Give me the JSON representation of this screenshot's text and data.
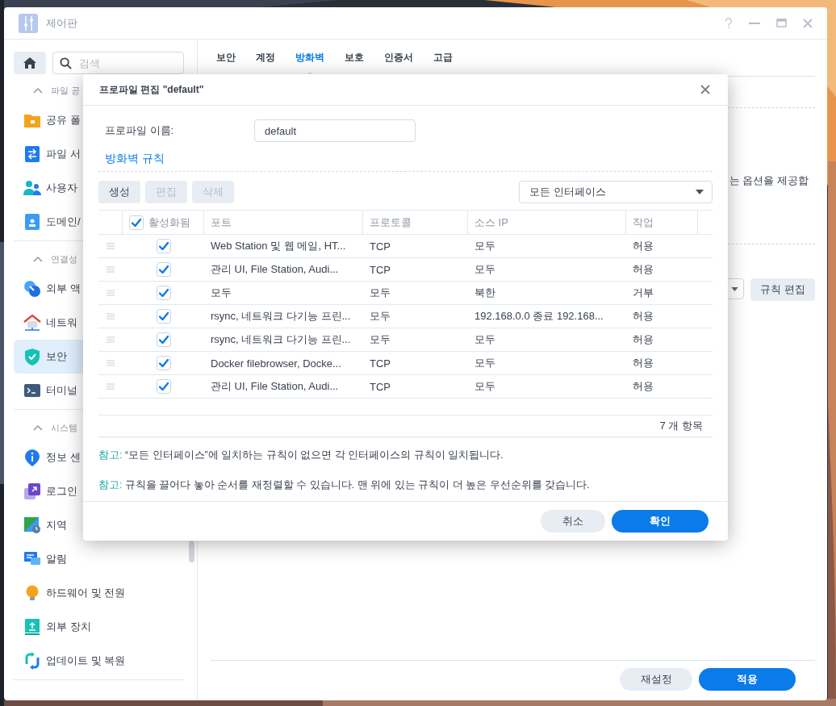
{
  "window": {
    "title": "제어판"
  },
  "sidebar": {
    "search_placeholder": "검색",
    "sections": [
      {
        "title": "파일 공",
        "expanded": true,
        "items": [
          {
            "label": "공유 폴",
            "selected": false
          },
          {
            "label": "파일 서",
            "selected": false
          },
          {
            "label": "사용자",
            "selected": false
          },
          {
            "label": "도메인/",
            "selected": false
          }
        ]
      },
      {
        "title": "연결성",
        "expanded": true,
        "items": [
          {
            "label": "외부 액",
            "selected": false
          },
          {
            "label": "네트워",
            "selected": false
          },
          {
            "label": "보안",
            "selected": true
          },
          {
            "label": "터미널",
            "selected": false
          }
        ]
      },
      {
        "title": "시스템",
        "expanded": true,
        "items": [
          {
            "label": "정보 센",
            "selected": false
          },
          {
            "label": "로그인",
            "selected": false
          },
          {
            "label": "지역",
            "selected": false
          },
          {
            "label": "알림",
            "selected": false
          },
          {
            "label": "하드웨어 및 전원",
            "selected": false
          },
          {
            "label": "외부 장치",
            "selected": false
          },
          {
            "label": "업데이트 및 복원",
            "selected": false
          }
        ]
      }
    ]
  },
  "main": {
    "tabs": [
      {
        "label": "보안",
        "selected": false
      },
      {
        "label": "계정",
        "selected": false
      },
      {
        "label": "방화벽",
        "selected": true
      },
      {
        "label": "보호",
        "selected": false
      },
      {
        "label": "인증서",
        "selected": false
      },
      {
        "label": "고급",
        "selected": false
      }
    ],
    "partial_text": "는 옵션을 제공합",
    "rule_button": "규칙 편집",
    "footer_buttons": [
      {
        "label": "재설정",
        "kind": "secondary"
      },
      {
        "label": "적용",
        "kind": "primary"
      }
    ]
  },
  "dialog": {
    "title": "프로파일 편집 \"default\"",
    "name_label": "프로파일 이름:",
    "name_value": "default",
    "section_title": "방화벽 규칙",
    "toolbar": [
      {
        "label": "생성",
        "disabled": false
      },
      {
        "label": "편집",
        "disabled": true
      },
      {
        "label": "삭제",
        "disabled": true
      }
    ],
    "interface_select": "모든 인터페이스",
    "header_checked": true,
    "columns": [
      "활성화됨",
      "포트",
      "프로토콜",
      "소스 IP",
      "작업"
    ],
    "rows": [
      {
        "enabled": true,
        "port": "Web Station 및 웹 메일, HT...",
        "protocol": "TCP",
        "source_ip": "모두",
        "action": "허용"
      },
      {
        "enabled": true,
        "port": "관리 UI, File Station, Audi...",
        "protocol": "TCP",
        "source_ip": "모두",
        "action": "허용"
      },
      {
        "enabled": true,
        "port": "모두",
        "protocol": "모두",
        "source_ip": "북한",
        "action": "거부"
      },
      {
        "enabled": true,
        "port": "rsync, 네트워크 다기능 프린...",
        "protocol": "모두",
        "source_ip": "192.168.0.0 종료 192.168...",
        "action": "허용"
      },
      {
        "enabled": true,
        "port": "rsync, 네트워크 다기능 프린...",
        "protocol": "모두",
        "source_ip": "모두",
        "action": "허용"
      },
      {
        "enabled": true,
        "port": "Docker filebrowser, Docke...",
        "protocol": "TCP",
        "source_ip": "모두",
        "action": "허용"
      },
      {
        "enabled": true,
        "port": "관리 UI, File Station, Audi...",
        "protocol": "TCP",
        "source_ip": "모두",
        "action": "허용"
      }
    ],
    "count": "7 개 항목",
    "notes": [
      {
        "label": "참고:",
        "text": "“모든 인터페이스”에 일치하는 규칙이 없으면 각 인터페이스의 규칙이 일치됩니다."
      },
      {
        "label": "참고:",
        "text": "규칙을 끌어다 놓아 순서를 재정렬할 수 있습니다. 맨 위에 있는 규칙이 더 높은 우선순위를 갖습니다."
      }
    ],
    "buttons": [
      {
        "label": "취소",
        "kind": "secondary"
      },
      {
        "label": "확인",
        "kind": "primary"
      }
    ]
  }
}
